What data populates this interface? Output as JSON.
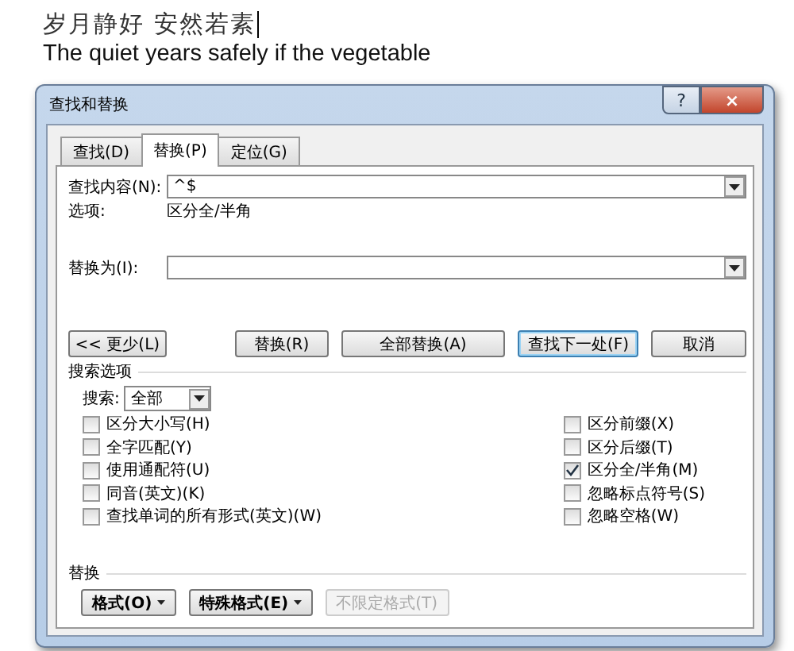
{
  "document": {
    "lines": [
      "岁月静好 安然若素",
      "The quiet years safely if the vegetable"
    ],
    "cursor": true
  },
  "dialog": {
    "title": "查找和替换",
    "help": "?",
    "close": "×",
    "tabs": [
      {
        "label": "查找(D)",
        "selected": false
      },
      {
        "label": "替换(P)",
        "selected": true
      },
      {
        "label": "定位(G)",
        "selected": false
      }
    ],
    "find": {
      "label": "查找内容(N):",
      "value": "^$"
    },
    "options": {
      "label": "选项:",
      "value": "区分全/半角"
    },
    "replace": {
      "label": "替换为(I):"
    },
    "buttons": [
      {
        "label": "<< 更少(L)",
        "focused": false
      },
      {
        "label": "替换(R)",
        "focused": false
      },
      {
        "label": "全部替换(A)",
        "focused": false
      },
      {
        "label": "查找下一处(F)",
        "focused": true
      },
      {
        "label": "取消",
        "focused": false
      }
    ],
    "search_options": {
      "heading": "搜索选项",
      "scope_label": "搜索:",
      "scope_value": "全部",
      "left": [
        {
          "label": "区分大小写(H)",
          "checked": false
        },
        {
          "label": "全字匹配(Y)",
          "checked": false
        },
        {
          "label": "使用通配符(U)",
          "checked": false
        },
        {
          "label": "同音(英文)(K)",
          "checked": false
        },
        {
          "label": "查找单词的所有形式(英文)(W)",
          "checked": false
        }
      ],
      "right": [
        {
          "label": "区分前缀(X)",
          "checked": false
        },
        {
          "label": "区分后缀(T)",
          "checked": false
        },
        {
          "label": "区分全/半角(M)",
          "checked": true
        },
        {
          "label": "忽略标点符号(S)",
          "checked": false
        },
        {
          "label": "忽略空格(W)",
          "checked": false
        }
      ]
    },
    "replace_section": {
      "heading": "替换",
      "buttons": [
        {
          "label": "格式(O)",
          "menu": true,
          "disabled": false
        },
        {
          "label": "特殊格式(E)",
          "menu": true,
          "disabled": false
        },
        {
          "label": "不限定格式(T)",
          "menu": false,
          "disabled": true
        }
      ]
    }
  }
}
